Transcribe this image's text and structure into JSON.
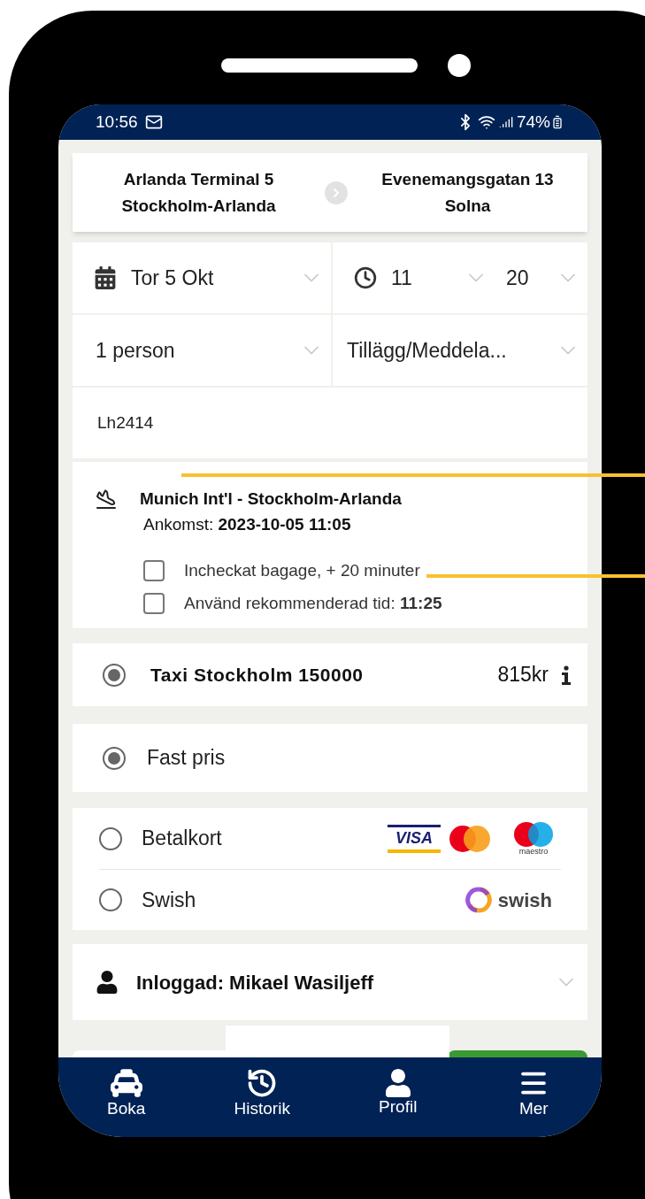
{
  "status_bar": {
    "time": "10:56",
    "battery": "74%"
  },
  "route": {
    "from": {
      "line1": "Arlanda Terminal 5",
      "line2": "Stockholm-Arlanda"
    },
    "to": {
      "line1": "Evenemangsgatan 13",
      "line2": "Solna"
    }
  },
  "form": {
    "date": "Tor 5 Okt",
    "hour": "11",
    "minute": "20",
    "passengers": "1 person",
    "extras": "Tillägg/Meddela...",
    "flight_number": "Lh2414"
  },
  "flight": {
    "route": "Munich Int'l - Stockholm-Arlanda",
    "arrival": "Ankomst: **2023-10-05 11:05**",
    "options": [
      {
        "label": "Incheckat bagage, + 20 minuter",
        "checked": false
      },
      {
        "label": "Använd rekommenderad tid: **11:25**",
        "checked": false
      }
    ]
  },
  "taxi": {
    "name": "Taxi Stockholm 150000",
    "price": "815kr",
    "selected": true
  },
  "pricing": [
    {
      "label": "Fast pris",
      "selected": true
    }
  ],
  "payment_methods": [
    {
      "label": "Betalkort",
      "selected": false,
      "kind": "cards",
      "logos": {
        "visa": "VISA",
        "maestro": "maestro"
      }
    },
    {
      "label": "Swish",
      "selected": false,
      "kind": "swish",
      "logos": {
        "swish": "swish"
      }
    }
  ],
  "user": {
    "label": "Inloggad: Mikael Wasiljeff"
  },
  "nav": [
    {
      "label": "Boka",
      "kind": "taxi"
    },
    {
      "label": "Historik",
      "kind": "history"
    },
    {
      "label": "Profil",
      "kind": "profile"
    },
    {
      "label": "Mer",
      "kind": "menu"
    }
  ]
}
